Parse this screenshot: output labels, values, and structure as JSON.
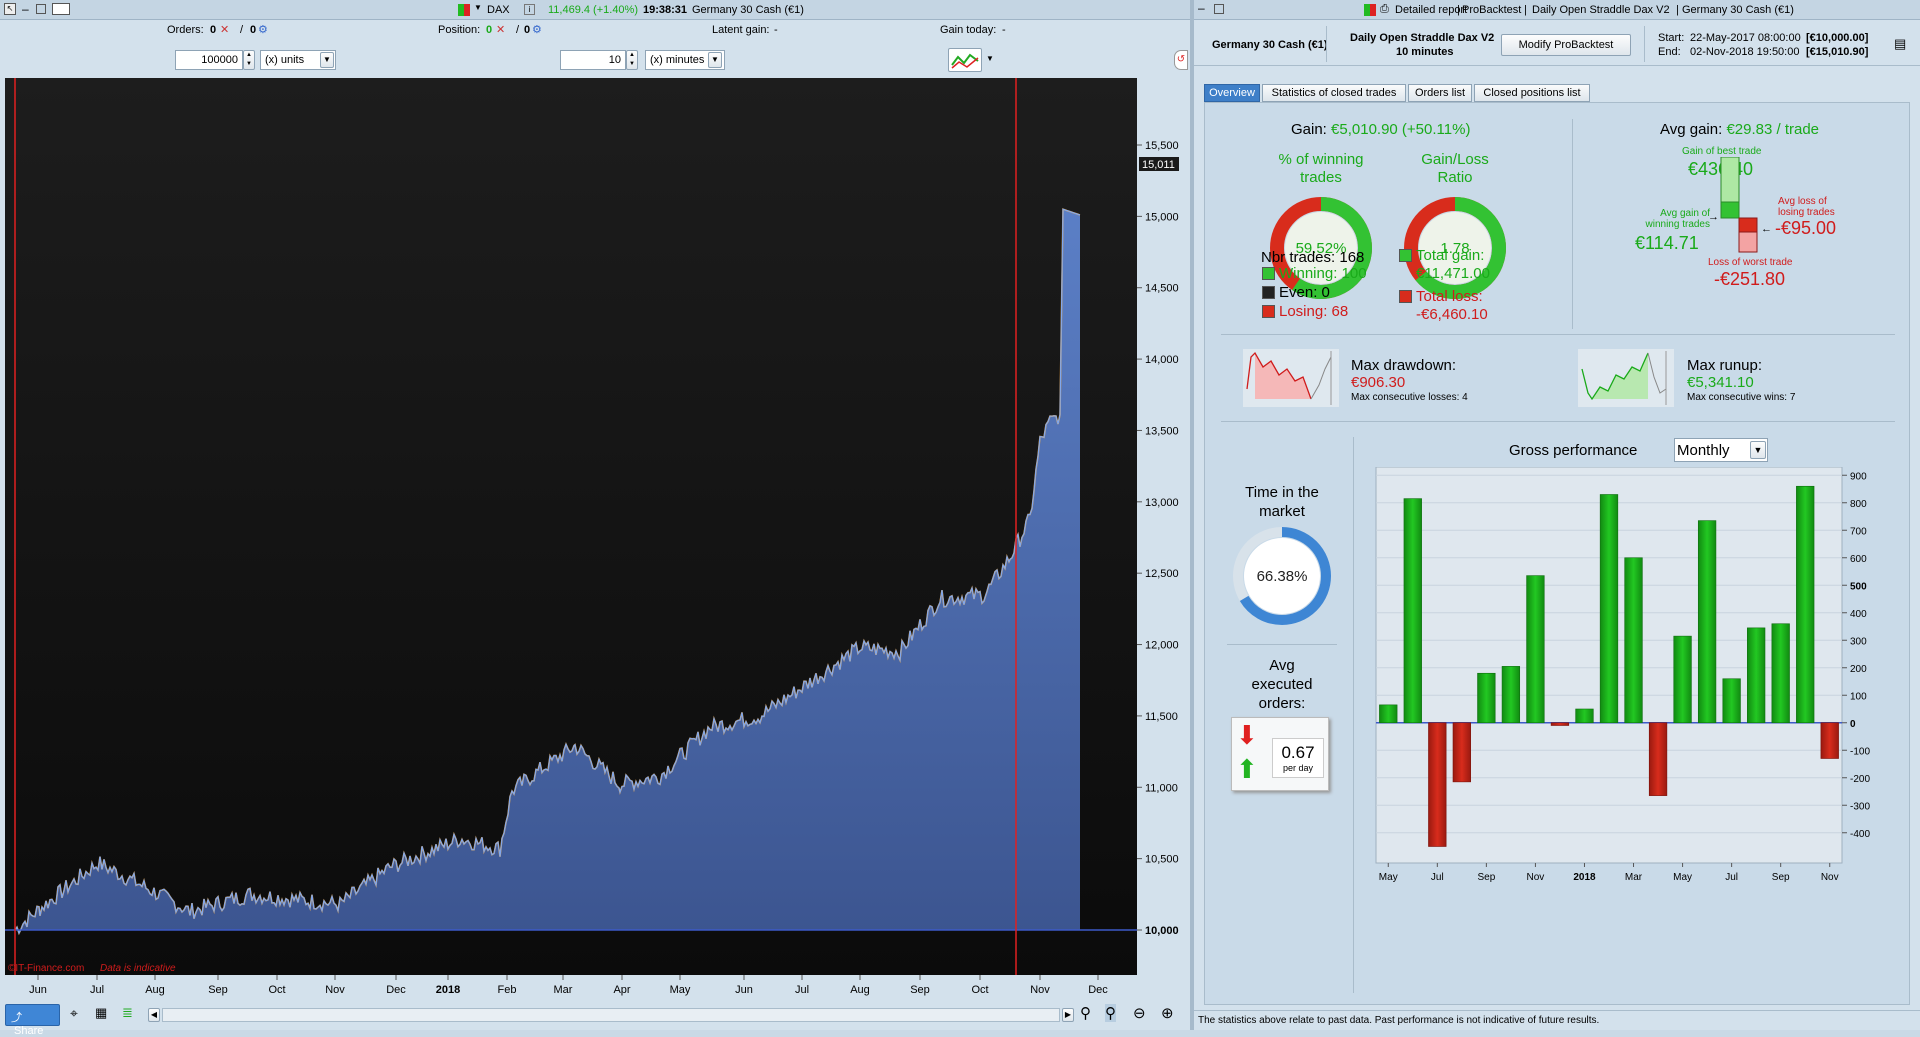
{
  "left": {
    "title": {
      "instrument": "DAX",
      "price": "11,469.4 (+1.40%)",
      "time": "19:38:31",
      "contract": "Germany 30 Cash (€1)"
    },
    "info": {
      "orders_label": "Orders:",
      "orders_val1": "0",
      "orders_val2": "0",
      "position_label": "Position:",
      "position_val1": "0",
      "position_val2": "0",
      "latent_label": "Latent gain:",
      "latent_val": "-",
      "gaintoday_label": "Gain today:",
      "gaintoday_val": "-"
    },
    "controls": {
      "units_value": "100000",
      "units_label": "(x) units",
      "minutes_value": "10",
      "minutes_label": "(x) minutes"
    },
    "chart": {
      "price_labels": [
        "15,500",
        "15,000",
        "14,500",
        "14,000",
        "13,500",
        "13,000",
        "12,500",
        "12,000",
        "11,500",
        "11,000",
        "10,500",
        "10,000"
      ],
      "price_values": [
        15500,
        15000,
        14500,
        14000,
        13500,
        13000,
        12500,
        12000,
        11500,
        11000,
        10500,
        10000
      ],
      "current_badge": "15,011",
      "month_labels": [
        "Jun",
        "Jul",
        "Aug",
        "Sep",
        "Oct",
        "Nov",
        "Dec",
        "2018",
        "Feb",
        "Mar",
        "Apr",
        "May",
        "Jun",
        "Jul",
        "Aug",
        "Sep",
        "Oct",
        "Nov",
        "Dec"
      ],
      "watermark_brand": "©IT-Finance.com",
      "watermark_note": "Data is indicative"
    },
    "status": {
      "share_label": "Share"
    }
  },
  "right": {
    "title": {
      "detailed": "Detailed report",
      "probacktest": "ProBacktest",
      "strategy": "Daily Open Straddle Dax V2",
      "contract": "Germany 30 Cash (€1)"
    },
    "header": {
      "instrument": "Germany 30 Cash (€1)",
      "strategy_name": "Daily Open Straddle Dax V2",
      "timeframe": "10 minutes",
      "modify_button": "Modify ProBacktest",
      "start_label": "Start:",
      "start_date": "22-May-2017 08:00:00",
      "start_value": "[€10,000.00]",
      "end_label": "End:",
      "end_date": "02-Nov-2018 19:50:00",
      "end_value": "[€15,010.90]"
    },
    "tabs": [
      "Overview",
      "Statistics of closed trades",
      "Orders list",
      "Closed positions list"
    ],
    "overview": {
      "gain_label": "Gain:",
      "gain_value": "€5,010.90 (+50.11%)",
      "pct_win_label1": "% of winning",
      "pct_win_label2": "trades",
      "pct_win_value": "59.52%",
      "pct_win_fraction": 0.5952,
      "ratio_label1": "Gain/Loss",
      "ratio_label2": "Ratio",
      "ratio_value": "1.78",
      "ratio_fraction": 0.64,
      "nbr_trades": "Nbr trades: 168",
      "winning": "Winning: 100",
      "even": "Even: 0",
      "losing": "Losing: 68",
      "total_gain_label": "Total gain:",
      "total_gain_value": "€11,471.00",
      "total_loss_label": "Total loss:",
      "total_loss_value": "-€6,460.10",
      "avg_gain_label": "Avg gain:",
      "avg_gain_value": "€29.83 / trade",
      "best_trade_label": "Gain of best trade",
      "best_trade_value": "€436.40",
      "avg_win_label1": "Avg gain of",
      "avg_win_label2": "winning trades",
      "avg_win_value": "€114.71",
      "avg_loss_label1": "Avg loss of",
      "avg_loss_label2": "losing trades",
      "avg_loss_value": "-€95.00",
      "worst_trade_label": "Loss of worst trade",
      "worst_trade_value": "-€251.80",
      "drawdown_label": "Max drawdown:",
      "drawdown_value": "€906.30",
      "drawdown_sub": "Max consecutive losses: 4",
      "runup_label": "Max runup:",
      "runup_value": "€5,341.10",
      "runup_sub": "Max consecutive wins: 7",
      "time_market_label1": "Time in the",
      "time_market_label2": "market",
      "time_market_value": "66.38%",
      "time_market_fraction": 0.6638,
      "avg_orders_label1": "Avg",
      "avg_orders_label2": "executed",
      "avg_orders_label3": "orders:",
      "avg_orders_value": "0.67",
      "avg_orders_unit": "per day",
      "gross_label": "Gross performance",
      "gross_period": "Monthly"
    },
    "chart_data": {
      "type": "bar",
      "title": "Gross performance",
      "categories": [
        "May 2017",
        "Jun 2017",
        "Jul 2017",
        "Aug 2017",
        "Sep 2017",
        "Oct 2017",
        "Nov 2017",
        "Dec 2017",
        "Jan 2018",
        "Feb 2018",
        "Mar 2018",
        "Apr 2018",
        "May 2018",
        "Jun 2018",
        "Jul 2018",
        "Aug 2018",
        "Sep 2018",
        "Oct 2018",
        "Nov 2018"
      ],
      "values": [
        65,
        815,
        -450,
        -215,
        180,
        205,
        535,
        -10,
        50,
        830,
        600,
        -265,
        315,
        735,
        160,
        345,
        360,
        860,
        -130
      ],
      "x_tick_labels": [
        "May",
        "Jul",
        "Sep",
        "Nov",
        "2018",
        "Mar",
        "May",
        "Jul",
        "Sep",
        "Nov"
      ],
      "y_ticks": [
        900,
        800,
        700,
        600,
        500,
        400,
        300,
        200,
        100,
        0,
        -100,
        -200,
        -300,
        -400
      ],
      "ylim": [
        -510,
        930
      ],
      "positive_color": "#22c822",
      "negative_color": "#d82c1c"
    },
    "footer": {
      "disclaimer": "The statistics above relate to past data. Past performance is not indicative of future results."
    }
  }
}
